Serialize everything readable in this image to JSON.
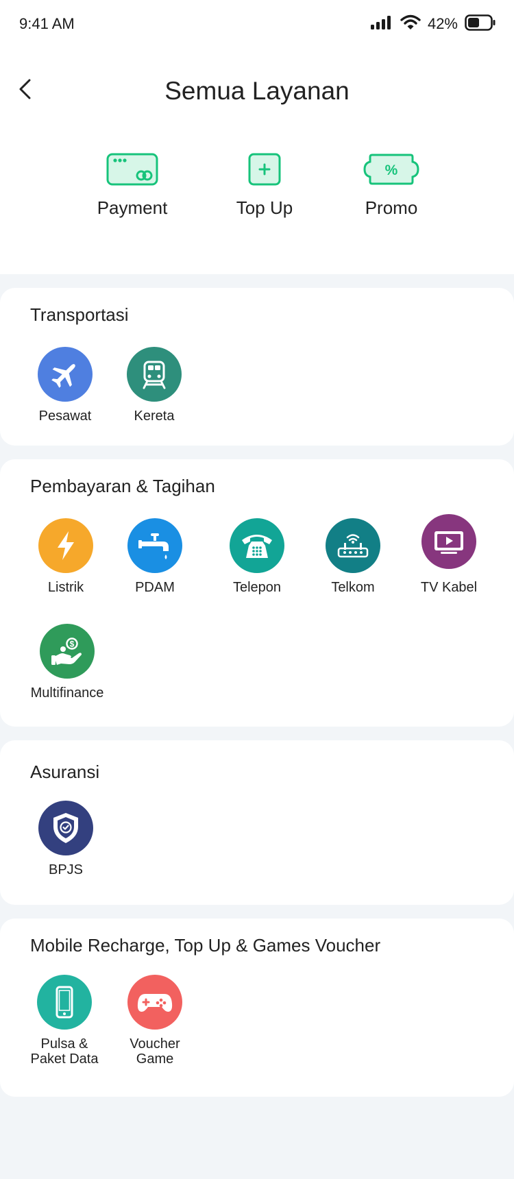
{
  "status_bar": {
    "time": "9:41 AM",
    "battery_percent": "42%",
    "icons": [
      "signal-icon",
      "wifi-icon",
      "battery-icon"
    ]
  },
  "header": {
    "title": "Semua Layanan",
    "back_icon": "chevron-left-icon"
  },
  "quick_actions": [
    {
      "label": "Payment",
      "icon": "payment-card-icon"
    },
    {
      "label": "Top Up",
      "icon": "top-up-icon"
    },
    {
      "label": "Promo",
      "icon": "promo-ticket-icon"
    }
  ],
  "sections": {
    "transportasi": {
      "title": "Transportasi",
      "items": [
        {
          "label": "Pesawat",
          "icon": "airplane-icon",
          "color": "#4f7fe0"
        },
        {
          "label": "Kereta",
          "icon": "train-icon",
          "color": "#2e8f7c"
        }
      ]
    },
    "pembayaran": {
      "title": "Pembayaran & Tagihan",
      "items": [
        {
          "label": "Listrik",
          "icon": "lightning-icon",
          "color": "#f6a82b"
        },
        {
          "label": "PDAM",
          "icon": "water-tap-icon",
          "color": "#1a8fe3"
        },
        {
          "label": "Telepon",
          "icon": "telephone-icon",
          "color": "#12a596"
        },
        {
          "label": "Telkom",
          "icon": "router-icon",
          "color": "#127f86"
        },
        {
          "label": "TV Kabel",
          "icon": "tv-icon",
          "color": "#87367e"
        },
        {
          "label": "Multifinance",
          "icon": "hand-coin-icon",
          "color": "#2f9b5a"
        }
      ]
    },
    "asuransi": {
      "title": "Asuransi",
      "items": [
        {
          "label": "BPJS",
          "icon": "shield-check-icon",
          "color": "#33407f"
        }
      ]
    },
    "mobile": {
      "title": "Mobile Recharge, Top Up & Games Voucher",
      "items": [
        {
          "label_line1": "Pulsa &",
          "label_line2": "Paket Data",
          "icon": "smartphone-icon",
          "color": "#22b3a0"
        },
        {
          "label_line1": "Voucher",
          "label_line2": "Game",
          "icon": "gamepad-icon",
          "color": "#f2615f"
        }
      ]
    }
  },
  "colors": {
    "accent_green": "#17c37b",
    "accent_green_light": "#d7f6e8",
    "page_background": "#f2f5f8"
  }
}
